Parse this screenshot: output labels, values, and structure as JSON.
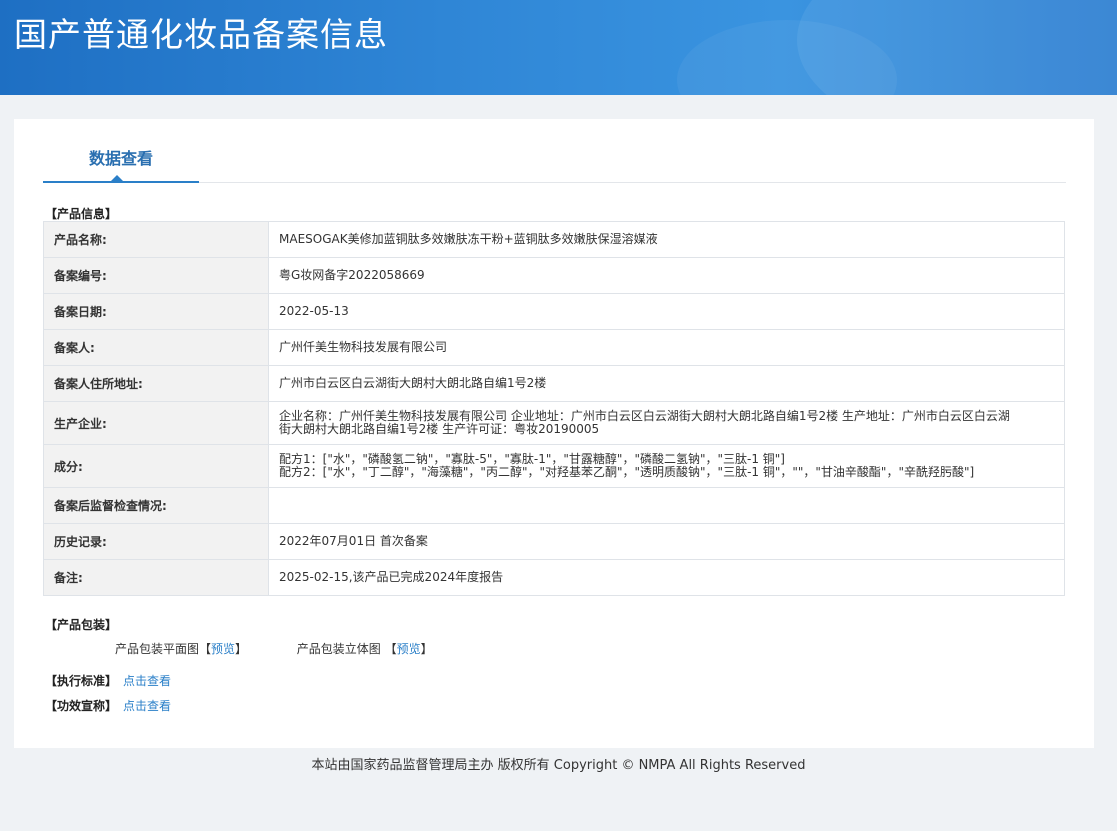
{
  "header": {
    "title": "国产普通化妆品备案信息"
  },
  "tab": {
    "label": "数据查看"
  },
  "sections": {
    "product_info": "【产品信息】",
    "packaging": "【产品包装】",
    "standard": "【执行标准】",
    "efficacy": "【功效宣称】"
  },
  "info": {
    "rows": [
      {
        "key": "产品名称:",
        "value": "MAESOGAK美修加蓝铜肽多效嫩肤冻干粉+蓝铜肽多效嫩肤保湿溶媒液"
      },
      {
        "key": "备案编号:",
        "value": "粤G妆网备字2022058669"
      },
      {
        "key": "备案日期:",
        "value": "2022-05-13"
      },
      {
        "key": "备案人:",
        "value": "广州仟美生物科技发展有限公司"
      },
      {
        "key": "备案人住所地址:",
        "value": "广州市白云区白云湖街大朗村大朗北路自编1号2楼"
      },
      {
        "key": "生产企业:",
        "value_line1": "企业名称：广州仟美生物科技发展有限公司 企业地址：广州市白云区白云湖街大朗村大朗北路自编1号2楼 生产地址：广州市白云区白云湖",
        "value_line2": "街大朗村大朗北路自编1号2楼 生产许可证：粤妆20190005"
      },
      {
        "key": "成分:",
        "value_line1": "配方1：[\"水\"，\"磷酸氢二钠\"，\"寡肽-5\"，\"寡肽-1\"，\"甘露糖醇\"，\"磷酸二氢钠\"，\"三肽-1 铜\"]",
        "value_line2": "配方2：[\"水\"，\"丁二醇\"，\"海藻糖\"，\"丙二醇\"，\"对羟基苯乙酮\"，\"透明质酸钠\"，\"三肽-1 铜\"，\"\"，\"甘油辛酸酯\"，\"辛酰羟肟酸\"]"
      },
      {
        "key": "备案后监督检查情况:",
        "value": ""
      },
      {
        "key": "历史记录:",
        "value": "2022年07月01日 首次备案"
      },
      {
        "key": "备注:",
        "value": "2025-02-15,该产品已完成2024年度报告"
      }
    ]
  },
  "packaging": {
    "flat_label": "产品包装平面图",
    "flat_link": "预览",
    "solid_label": "产品包装立体图",
    "solid_link": "预览",
    "bracket_open": "【",
    "bracket_close": "】"
  },
  "links": {
    "standard": "点击查看",
    "efficacy": "点击查看"
  },
  "footer": {
    "text": "本站由国家药品监督管理局主办 版权所有 Copyright © NMPA All Rights Reserved"
  }
}
